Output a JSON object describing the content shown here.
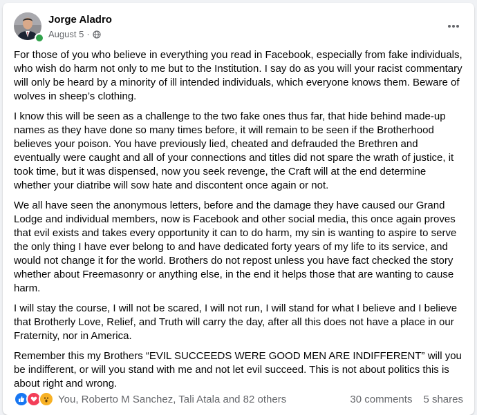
{
  "post": {
    "author": "Jorge Aladro",
    "date": "August 5",
    "separator": "·",
    "privacy_icon": "globe-icon",
    "paragraphs": [
      "For those of you who believe in everything you read in Facebook, especially from fake individuals, who wish do harm not only to me but to the Institution. I say do as you will your racist commentary will only be heard by a minority of ill intended individuals, which everyone knows them. Beware of wolves in sheep’s clothing.",
      "I know this will be seen as a challenge to the two fake ones thus far, that hide behind made-up names as they have done so many times before, it will remain to be seen if the Brotherhood believes your poison. You have previously lied, cheated and defrauded the Brethren and eventually were caught and all of your connections and titles did not spare the wrath of justice, it took time, but it was dispensed, now you seek revenge, the Craft will at the end determine whether your diatribe will sow hate and discontent once again or not.",
      "We all have seen the anonymous letters, before and the damage they have caused our Grand Lodge and individual members, now is Facebook and other social media, this once again proves that evil exists and takes every opportunity it can to do harm, my sin is wanting to aspire to serve the only thing I have ever belong to and have dedicated forty years of my life to its service, and would not change it for the world. Brothers do not repost unless you have fact checked the story whether about Freemasonry or anything else, in the end it helps those that are wanting to cause harm.",
      "I will stay the course, I will not be scared, I will not run, I will stand for what I believe and  I believe that Brotherly Love, Relief, and Truth will carry the day, after all this does not have a place in our Fraternity, nor in America.",
      "Remember this my Brothers “EVIL SUCCEEDS WERE GOOD MEN ARE INDIFFERENT” will you be indifferent, or will you stand with me and not let evil succeed. This is not about politics this is about right and wrong."
    ],
    "reactions_text": "You, Roberto M Sanchez, Tali Atala and 82 others",
    "reaction_icons": [
      "like-icon",
      "love-icon",
      "wow-icon"
    ],
    "comments": "30 comments",
    "shares": "5 shares"
  },
  "colors": {
    "like": "#1877f2",
    "love": "#f33e58",
    "wow": "#f7b125",
    "online": "#31a24c",
    "secondary_text": "#65676b"
  }
}
